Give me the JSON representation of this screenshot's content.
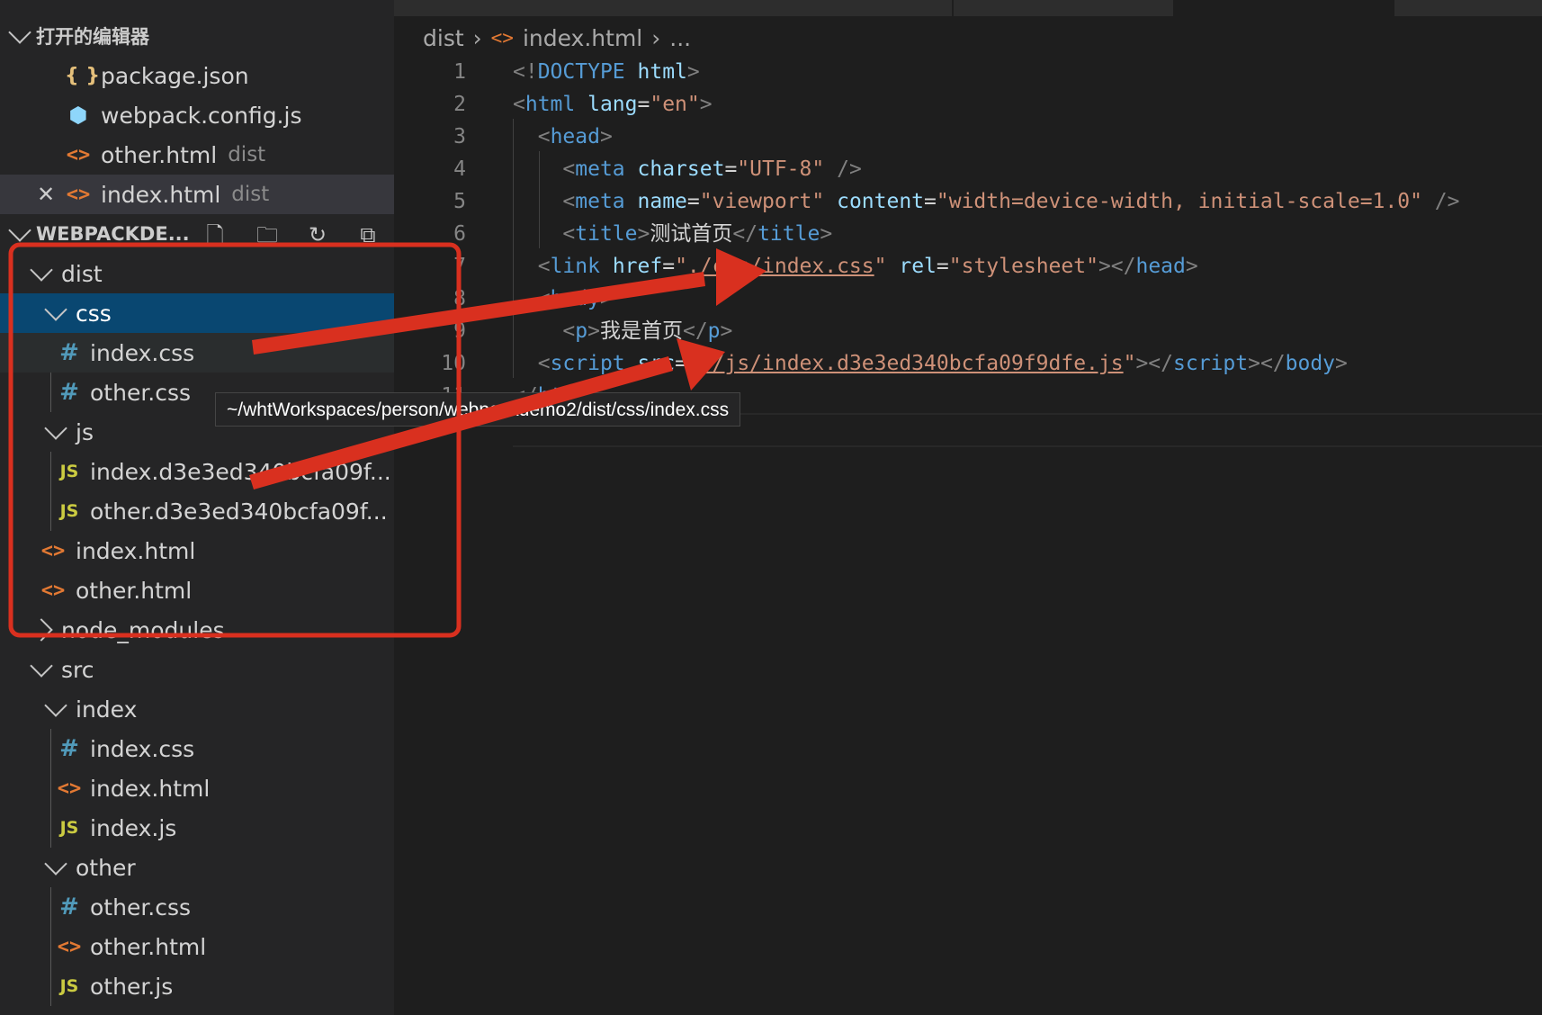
{
  "open_editors": {
    "header": "打开的编辑器",
    "items": [
      {
        "icon": "{}",
        "name": "package.json",
        "desc": ""
      },
      {
        "icon": "webpack",
        "name": "webpack.config.js",
        "desc": ""
      },
      {
        "icon": "<>",
        "name": "other.html",
        "desc": "dist"
      },
      {
        "icon": "<>",
        "name": "index.html",
        "desc": "dist"
      }
    ]
  },
  "explorer": {
    "header": "WEBPACKDE...",
    "tree": [
      {
        "name": "dist"
      },
      {
        "name": "css"
      },
      {
        "icon": "#",
        "name": "index.css"
      },
      {
        "icon": "#",
        "name": "other.css"
      },
      {
        "name": "js"
      },
      {
        "icon": "JS",
        "name": "index.d3e3ed340bcfa09f..."
      },
      {
        "icon": "JS",
        "name": "other.d3e3ed340bcfa09f..."
      },
      {
        "icon": "<>",
        "name": "index.html"
      },
      {
        "icon": "<>",
        "name": "other.html"
      },
      {
        "name": "node_modules"
      },
      {
        "name": "src"
      },
      {
        "name": "index"
      },
      {
        "icon": "#",
        "name": "index.css"
      },
      {
        "icon": "<>",
        "name": "index.html"
      },
      {
        "icon": "JS",
        "name": "index.js"
      },
      {
        "name": "other"
      },
      {
        "icon": "#",
        "name": "other.css"
      },
      {
        "icon": "<>",
        "name": "other.html"
      },
      {
        "icon": "JS",
        "name": "other.js"
      }
    ]
  },
  "breadcrumb": {
    "folder": "dist",
    "file": "index.html",
    "more": "..."
  },
  "code": {
    "line_numbers": [
      "1",
      "2",
      "3",
      "4",
      "5",
      "6",
      "7",
      "8",
      "9",
      "10",
      "11"
    ],
    "title_text": "测试首页",
    "p_text": "我是首页",
    "css_href": "./css/index.css",
    "js_src": "./js/index.d3e3ed340bcfa09f9dfe.js"
  },
  "tooltip": "~/whtWorkspaces/person/webpackdemo2/dist/css/index.css",
  "colors": {
    "annotation_red": "#d9301f",
    "selection": "#094771"
  }
}
